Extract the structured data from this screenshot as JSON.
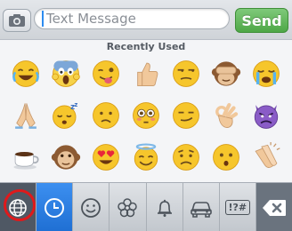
{
  "top_bar": {
    "camera_icon": "camera-icon",
    "message_placeholder": "Text Message",
    "send_label": "Send",
    "send_color": "#5aaf50"
  },
  "emoji_panel": {
    "section_title": "Recently Used",
    "emojis": [
      "face-with-tears-of-joy",
      "screaming-face",
      "winking-tongue-face",
      "thumbs-up",
      "unamused-face",
      "see-no-evil-monkey",
      "crying-face",
      "folded-hands",
      "sleeping-face",
      "confused-face",
      "flushed-face",
      "smirking-face",
      "ok-hand",
      "angry-devil",
      "hot-beverage",
      "monkey-face",
      "heart-eyes-face",
      "smiling-face-with-halo",
      "worried-face",
      "hushed-face",
      "clapping-hands"
    ]
  },
  "category_bar": {
    "items": [
      "globe-icon",
      "clock-icon",
      "smiley-icon",
      "flower-icon",
      "bell-icon",
      "car-icon",
      "symbols-icon",
      "delete-icon"
    ],
    "symbols_label": "!?#",
    "active_color": "#2a7fe6",
    "highlight_color": "#e0191b"
  }
}
